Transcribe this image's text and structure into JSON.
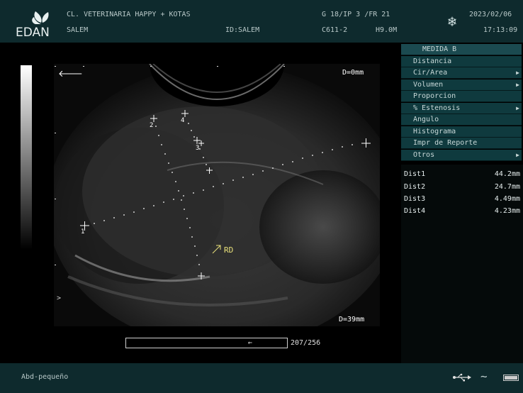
{
  "header": {
    "brand": "EDAN",
    "clinic": "CL. VETERINARIA HAPPY + KOTAS",
    "patient": "SALEM",
    "patient_id": "ID:SALEM",
    "gain_info": "G 18/IP 3 /FR 21",
    "probe": "C611-2",
    "freq": "H9.0M",
    "date": "2023/02/06",
    "time": "17:13:09"
  },
  "image": {
    "depth_top": "D=0mm",
    "depth_bottom": "D=39mm",
    "annotation": "RD",
    "caliper_labels": [
      "1",
      "2",
      "3",
      "4"
    ],
    "left_marker": ">"
  },
  "menu": {
    "title": "MEDIDA B",
    "items": [
      {
        "label": "Distancia",
        "arrow": ""
      },
      {
        "label": "Cir/Area",
        "arrow": "▶"
      },
      {
        "label": "Volumen",
        "arrow": "▶"
      },
      {
        "label": "Proporcion",
        "arrow": ""
      },
      {
        "label": "% Estenosis",
        "arrow": "▶"
      },
      {
        "label": "Angulo",
        "arrow": ""
      },
      {
        "label": "Histograma",
        "arrow": ""
      },
      {
        "label": "Impr de Reporte",
        "arrow": ""
      },
      {
        "label": "Otros",
        "arrow": "▶"
      }
    ]
  },
  "results": [
    {
      "name": "Dist1",
      "value": "44.2mm"
    },
    {
      "name": "Dist2",
      "value": "24.7mm"
    },
    {
      "name": "Dist3",
      "value": "4.49mm"
    },
    {
      "name": "Dist4",
      "value": "4.23mm"
    }
  ],
  "cine": {
    "frame": "207/256",
    "progress": 0.81
  },
  "footer": {
    "preset": "Abd-pequeño"
  }
}
